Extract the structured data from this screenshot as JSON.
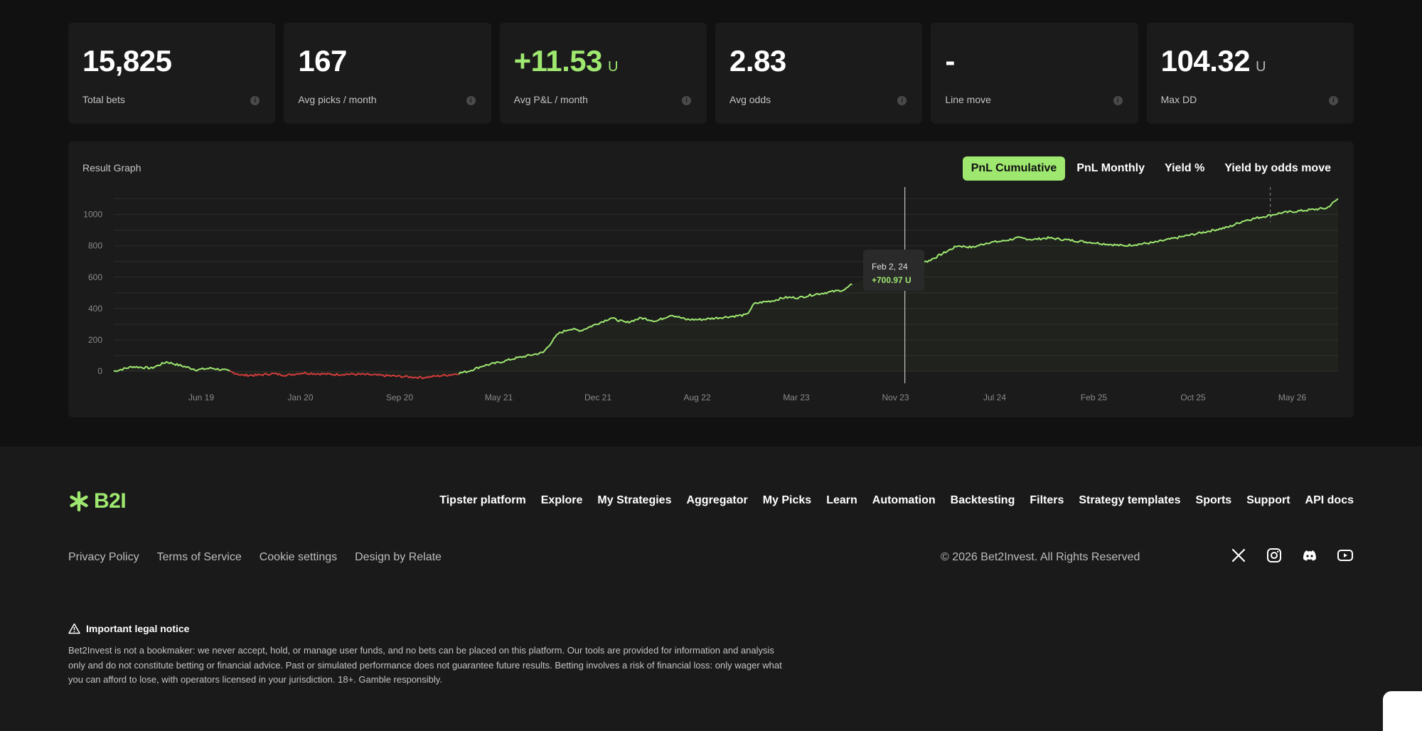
{
  "stats": [
    {
      "value": "15,825",
      "unit": "",
      "label": "Total bets",
      "color": "#ffffff"
    },
    {
      "value": "167",
      "unit": "",
      "label": "Avg picks / month",
      "color": "#ffffff"
    },
    {
      "value": "+11.53",
      "unit": "U",
      "label": "Avg P&L / month",
      "color": "#9fe870"
    },
    {
      "value": "2.83",
      "unit": "",
      "label": "Avg odds",
      "color": "#ffffff"
    },
    {
      "value": "-",
      "unit": "",
      "label": "Line move",
      "color": "#ffffff"
    },
    {
      "value": "104.32",
      "unit": "U",
      "label": "Max DD",
      "color": "#ffffff"
    }
  ],
  "info_icon": "info-icon",
  "graph": {
    "title": "Result Graph",
    "tabs": [
      "PnL Cumulative",
      "PnL Monthly",
      "Yield %",
      "Yield by odds move"
    ],
    "active_tab": "PnL Cumulative",
    "tooltip": {
      "date": "Feb 2, 24",
      "value": "+700.97 U"
    }
  },
  "chart_data": {
    "type": "line",
    "x_tick_labels": [
      "Jun 19",
      "Jan 20",
      "Sep 20",
      "May 21",
      "Dec 21",
      "Aug 22",
      "Mar 23",
      "Nov 23",
      "Jul 24",
      "Feb 25",
      "Oct 25",
      "May 26"
    ],
    "y_tick_labels": [
      "0",
      "200",
      "400",
      "600",
      "800",
      "1000"
    ],
    "ylim": [
      -40,
      1120
    ],
    "grid": true,
    "colors": {
      "positive": "#9fe870",
      "negative": "#d23b3b"
    },
    "series": [
      {
        "x": [
          0,
          5,
          10,
          14,
          18,
          22,
          26,
          30,
          34,
          38,
          42,
          46,
          50,
          54,
          58,
          62,
          66,
          70,
          74,
          78,
          82,
          86,
          90,
          94,
          98,
          102,
          106,
          110,
          114,
          116,
          118,
          121,
          124,
          128,
          132,
          136,
          140,
          144,
          148,
          152,
          156,
          160,
          164,
          168,
          170,
          172,
          175,
          178,
          182,
          186,
          190,
          194,
          196
        ],
        "y": [
          0,
          30,
          20,
          60,
          35,
          10,
          20,
          5,
          -25,
          -25,
          -15,
          -25,
          -10,
          -15,
          -20,
          -18,
          -20,
          -25,
          -30,
          -35,
          -40,
          -30,
          -20,
          0,
          35,
          55,
          80,
          100,
          120,
          180,
          240,
          270,
          260,
          300,
          340,
          310,
          340,
          320,
          360,
          330,
          330,
          340,
          350,
          360,
          430,
          440,
          450,
          470,
          470,
          490,
          505,
          520,
          555
        ],
        "note": ""
      },
      {
        "x": [
          210,
          212,
          216,
          220,
          224,
          228,
          232,
          236,
          240,
          244,
          248,
          252,
          256,
          260,
          264,
          268,
          272,
          276,
          280,
          284,
          288,
          292,
          296,
          298,
          300,
          304,
          308,
          310,
          314,
          318,
          322,
          325
        ],
        "y": [
          700.97,
          720,
          700,
          750,
          800,
          790,
          820,
          830,
          850,
          840,
          850,
          840,
          830,
          820,
          810,
          800,
          810,
          820,
          840,
          860,
          880,
          900,
          920,
          940,
          960,
          980,
          1000,
          1010,
          1020,
          1030,
          1040,
          1100
        ]
      }
    ]
  },
  "footer": {
    "logo_text": "B2I",
    "nav": [
      "Tipster platform",
      "Explore",
      "My Strategies",
      "Aggregator",
      "My Picks",
      "Learn",
      "Automation",
      "Backtesting",
      "Filters",
      "Strategy templates",
      "Sports",
      "Support",
      "API docs"
    ],
    "legal_links": [
      "Privacy Policy",
      "Terms of Service",
      "Cookie settings",
      "Design by Relate"
    ],
    "copyright": "© 2026 Bet2Invest. All Rights Reserved",
    "socials": [
      "x-icon",
      "instagram-icon",
      "discord-icon",
      "youtube-icon"
    ],
    "notice_title": "Important legal notice",
    "notice_text": "Bet2Invest is not a bookmaker: we never accept, hold, or manage user funds, and no bets can be placed on this platform. Our tools are provided for information and analysis only and do not constitute betting or financial advice. Past or simulated performance does not guarantee future results. Betting involves a risk of financial loss: only wager what you can afford to lose, with operators licensed in your jurisdiction. 18+. Gamble responsibly."
  }
}
